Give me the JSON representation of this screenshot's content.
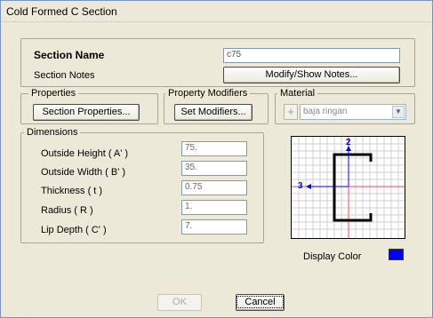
{
  "window": {
    "title": "Cold Formed C Section"
  },
  "section": {
    "name_label": "Section Name",
    "name_value": "c75",
    "notes_label": "Section Notes",
    "notes_button": "Modify/Show Notes..."
  },
  "properties": {
    "legend": "Properties",
    "button": "Section Properties..."
  },
  "modifiers": {
    "legend": "Property Modifiers",
    "button": "Set Modifiers..."
  },
  "material": {
    "legend": "Material",
    "plus": "+",
    "selected": "baja ringan"
  },
  "dimensions": {
    "legend": "Dimensions",
    "rows": [
      {
        "label": "Outside Height  ( A' )",
        "value": "75."
      },
      {
        "label": "Outside Width  ( B' )",
        "value": "35."
      },
      {
        "label": "Thickness  ( t )",
        "value": "0.75"
      },
      {
        "label": "Radius  ( R )",
        "value": "1."
      },
      {
        "label": "Lip Depth  ( C' )",
        "value": "7."
      }
    ]
  },
  "preview": {
    "axis_2": "2",
    "axis_3": "3"
  },
  "display_color": {
    "label": "Display Color",
    "color": "#0000ff"
  },
  "buttons": {
    "ok": "OK",
    "cancel": "Cancel"
  }
}
